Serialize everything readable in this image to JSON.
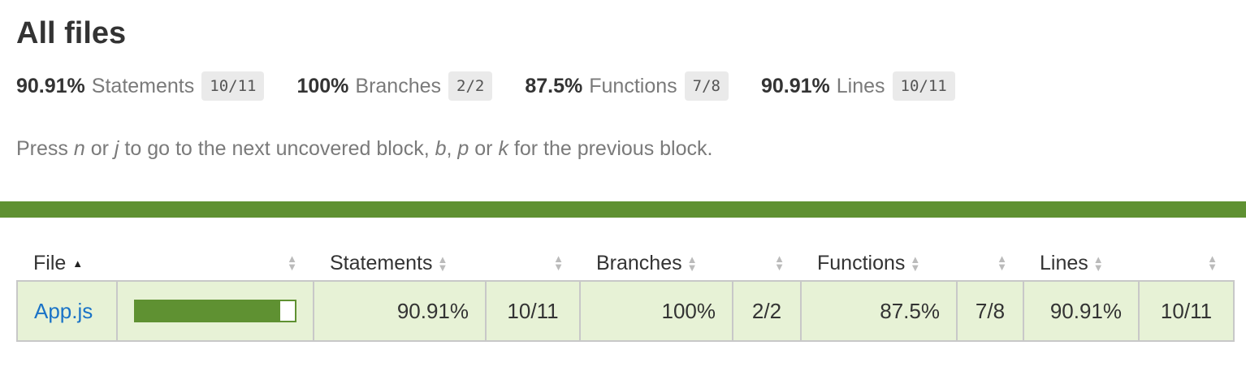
{
  "title": "All files",
  "summary": [
    {
      "pct": "90.91%",
      "label": "Statements",
      "frac": "10/11"
    },
    {
      "pct": "100%",
      "label": "Branches",
      "frac": "2/2"
    },
    {
      "pct": "87.5%",
      "label": "Functions",
      "frac": "7/8"
    },
    {
      "pct": "90.91%",
      "label": "Lines",
      "frac": "10/11"
    }
  ],
  "hint": {
    "p1": "Press ",
    "k1": "n",
    "p2": " or ",
    "k2": "j",
    "p3": " to go to the next uncovered block, ",
    "k3": "b",
    "p4": ", ",
    "k4": "p",
    "p5": " or ",
    "k5": "k",
    "p6": " for the previous block."
  },
  "colors": {
    "status_high": "#5f9132",
    "row_high": "#e7f2d6",
    "link": "#1a73c7"
  },
  "table": {
    "headers": {
      "file": "File",
      "statements": "Statements",
      "branches": "Branches",
      "functions": "Functions",
      "lines": "Lines"
    },
    "rows": [
      {
        "file": "App.js",
        "coverage_fraction": 0.9091,
        "statements_pct": "90.91%",
        "statements_frac": "10/11",
        "branches_pct": "100%",
        "branches_frac": "2/2",
        "functions_pct": "87.5%",
        "functions_frac": "7/8",
        "lines_pct": "90.91%",
        "lines_frac": "10/11"
      }
    ]
  }
}
